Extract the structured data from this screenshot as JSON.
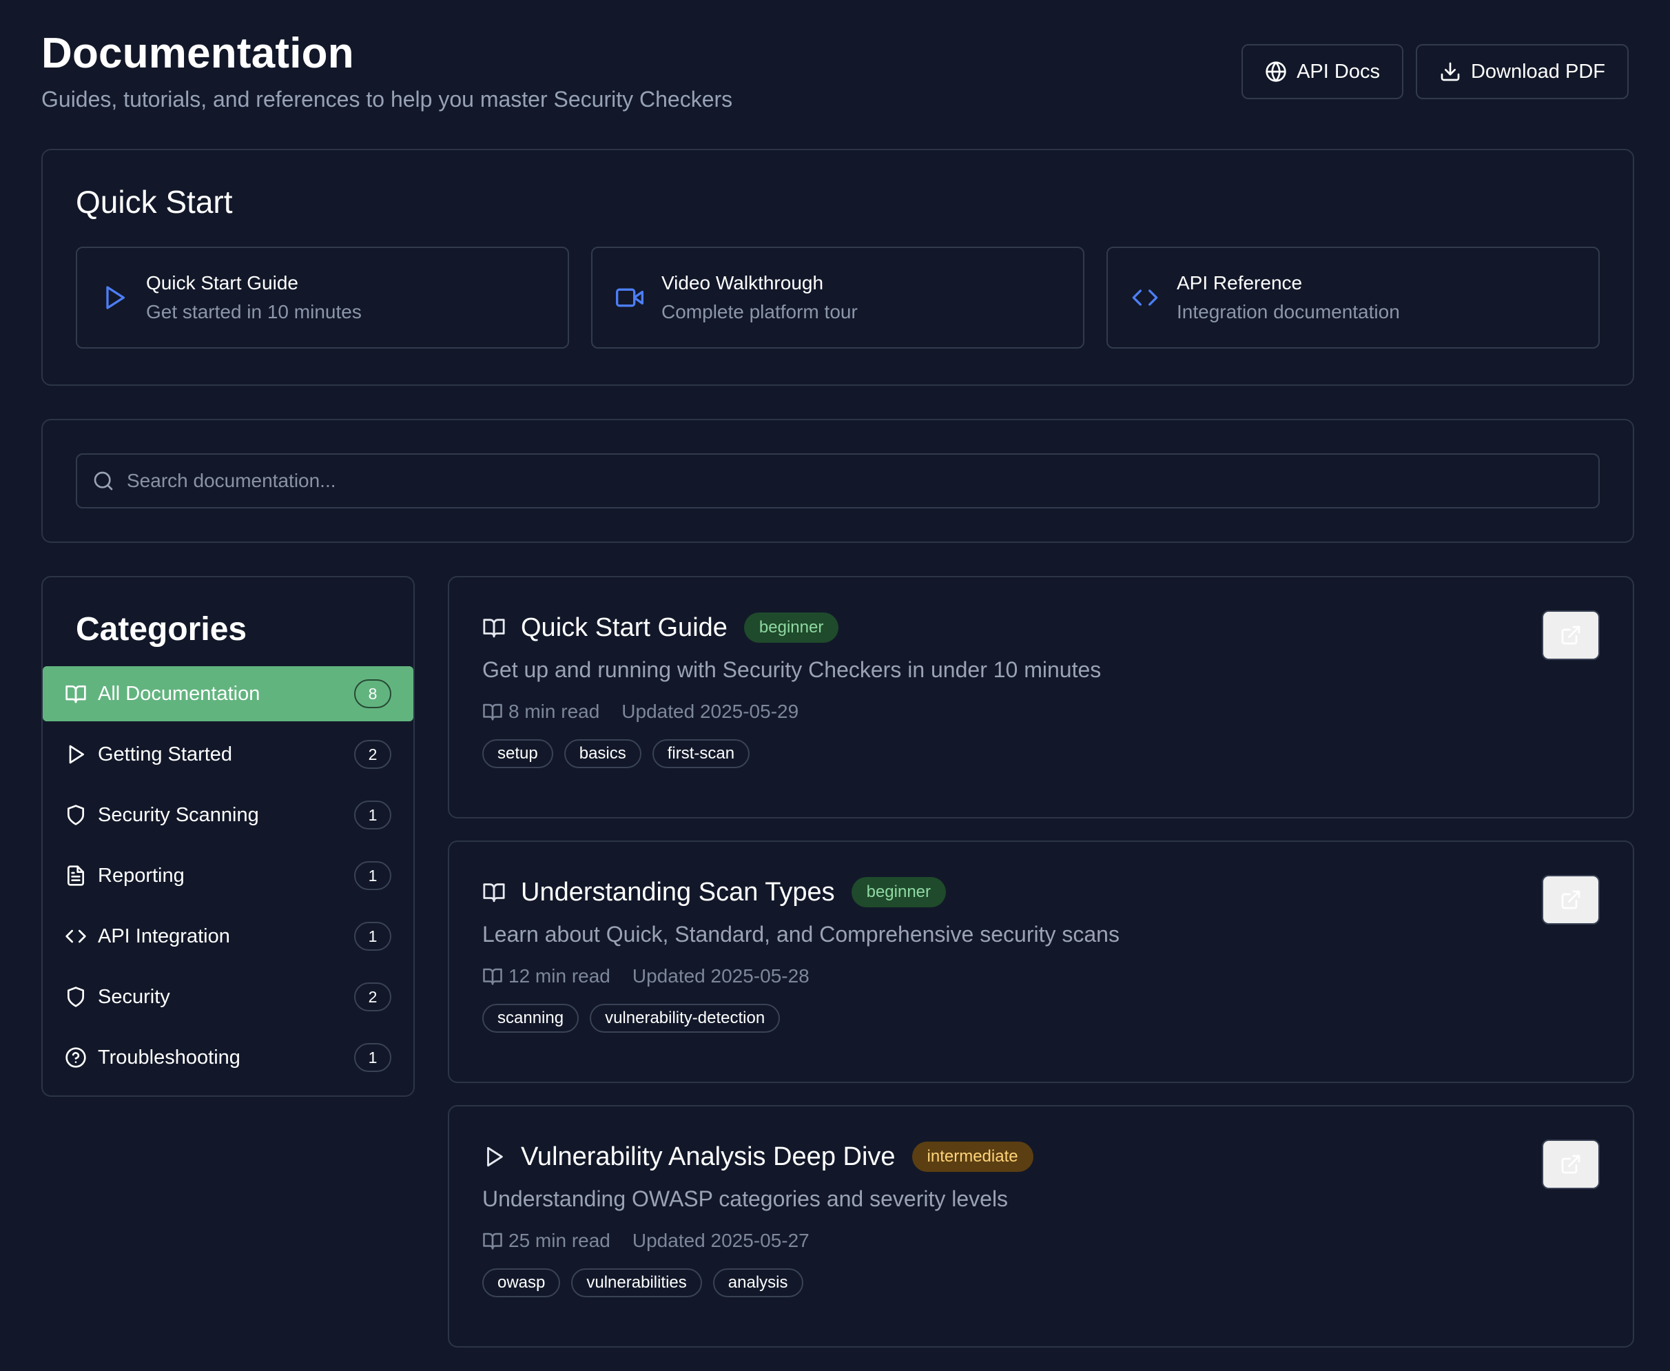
{
  "header": {
    "title": "Documentation",
    "subtitle": "Guides, tutorials, and references to help you master Security Checkers",
    "api_docs_label": "API Docs",
    "download_pdf_label": "Download PDF"
  },
  "quick_start": {
    "heading": "Quick Start",
    "items": [
      {
        "title": "Quick Start Guide",
        "desc": "Get started in 10 minutes",
        "icon": "play-icon"
      },
      {
        "title": "Video Walkthrough",
        "desc": "Complete platform tour",
        "icon": "video-icon"
      },
      {
        "title": "API Reference",
        "desc": "Integration documentation",
        "icon": "code-icon"
      }
    ]
  },
  "search": {
    "placeholder": "Search documentation..."
  },
  "sidebar": {
    "heading": "Categories",
    "items": [
      {
        "label": "All Documentation",
        "count": "8",
        "icon": "book-icon",
        "active": true
      },
      {
        "label": "Getting Started",
        "count": "2",
        "icon": "play-icon"
      },
      {
        "label": "Security Scanning",
        "count": "1",
        "icon": "shield-icon"
      },
      {
        "label": "Reporting",
        "count": "1",
        "icon": "file-text-icon"
      },
      {
        "label": "API Integration",
        "count": "1",
        "icon": "code-icon"
      },
      {
        "label": "Security",
        "count": "2",
        "icon": "shield-icon"
      },
      {
        "label": "Troubleshooting",
        "count": "1",
        "icon": "help-circle-icon"
      }
    ]
  },
  "docs": [
    {
      "title": "Quick Start Guide",
      "level": "beginner",
      "icon": "book-icon",
      "desc": "Get up and running with Security Checkers in under 10 minutes",
      "read": "8 min read",
      "updated": "Updated 2025-05-29",
      "tags": [
        "setup",
        "basics",
        "first-scan"
      ]
    },
    {
      "title": "Understanding Scan Types",
      "level": "beginner",
      "icon": "book-icon",
      "desc": "Learn about Quick, Standard, and Comprehensive security scans",
      "read": "12 min read",
      "updated": "Updated 2025-05-28",
      "tags": [
        "scanning",
        "vulnerability-detection"
      ]
    },
    {
      "title": "Vulnerability Analysis Deep Dive",
      "level": "intermediate",
      "icon": "play-icon",
      "desc": "Understanding OWASP categories and severity levels",
      "read": "25 min read",
      "updated": "Updated 2025-05-27",
      "tags": [
        "owasp",
        "vulnerabilities",
        "analysis"
      ]
    }
  ],
  "colors": {
    "background": "#121829",
    "accent_blue": "#4d7ef7",
    "active_green": "#62b47f",
    "beginner_badge": "#1f4a2b",
    "intermediate_badge": "#5b3f12"
  }
}
